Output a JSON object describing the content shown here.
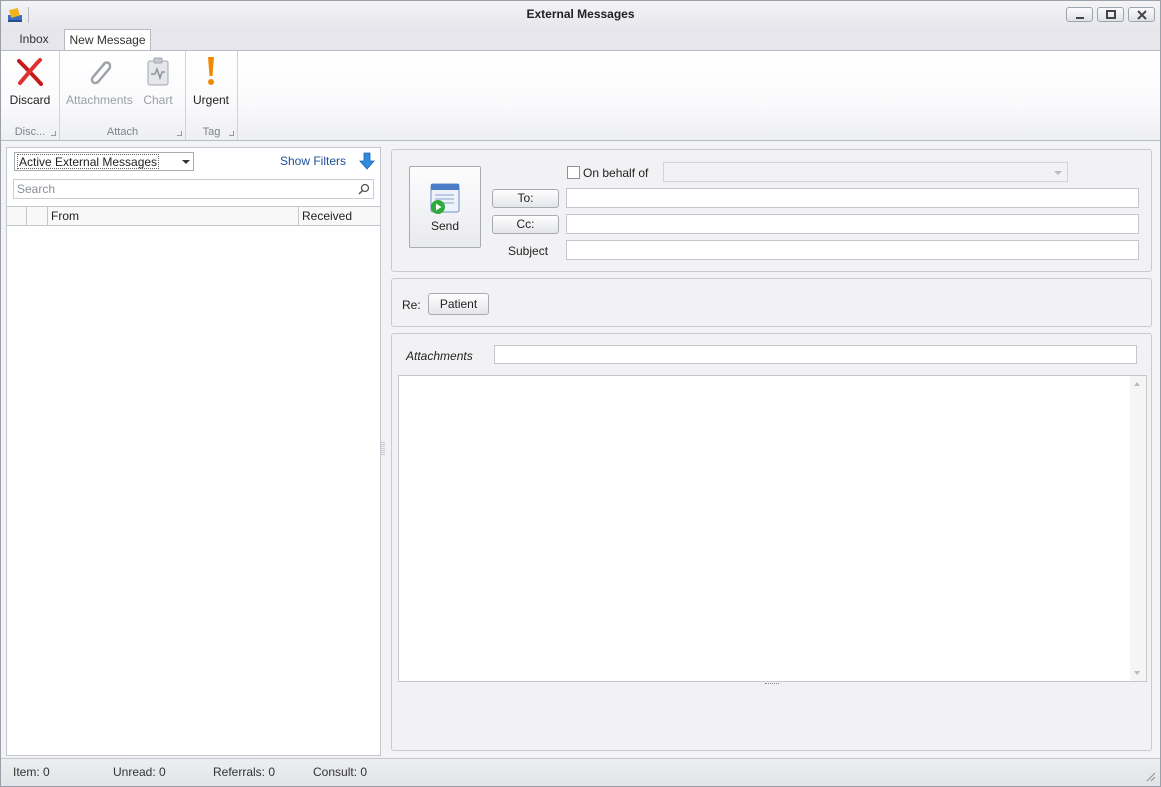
{
  "window": {
    "title": "External Messages"
  },
  "tabs": [
    {
      "label": "Inbox",
      "active": false
    },
    {
      "label": "New Message",
      "active": true
    }
  ],
  "ribbon": {
    "groups": [
      {
        "label": "Disc...",
        "buttons": [
          {
            "label": "Discard",
            "icon": "discard-x-icon",
            "enabled": true
          }
        ]
      },
      {
        "label": "Attach",
        "buttons": [
          {
            "label": "Attachments",
            "icon": "paperclip-icon",
            "enabled": false
          },
          {
            "label": "Chart",
            "icon": "chart-clipboard-icon",
            "enabled": false
          }
        ]
      },
      {
        "label": "Tag",
        "buttons": [
          {
            "label": "Urgent",
            "icon": "exclamation-icon",
            "enabled": true
          }
        ]
      }
    ]
  },
  "left": {
    "filter_selected": "Active External Messages",
    "show_filters": "Show Filters",
    "search_placeholder": "Search",
    "columns": [
      "From",
      "Received"
    ]
  },
  "compose": {
    "send_label": "Send",
    "on_behalf_label": "On behalf of",
    "on_behalf_checked": false,
    "to_label": "To:",
    "cc_label": "Cc:",
    "subject_label": "Subject",
    "to_value": "",
    "cc_value": "",
    "subject_value": "",
    "re_label": "Re:",
    "patient_button": "Patient",
    "attachments_label": "Attachments"
  },
  "status": {
    "item": "Item: 0",
    "unread": "Unread: 0",
    "referrals": "Referrals: 0",
    "consult": "Consult: 0"
  },
  "colors": {
    "link": "#1e4f9a",
    "discard_red": "#d42020",
    "urgent_orange": "#f08a00",
    "send_green": "#2faa3c"
  }
}
